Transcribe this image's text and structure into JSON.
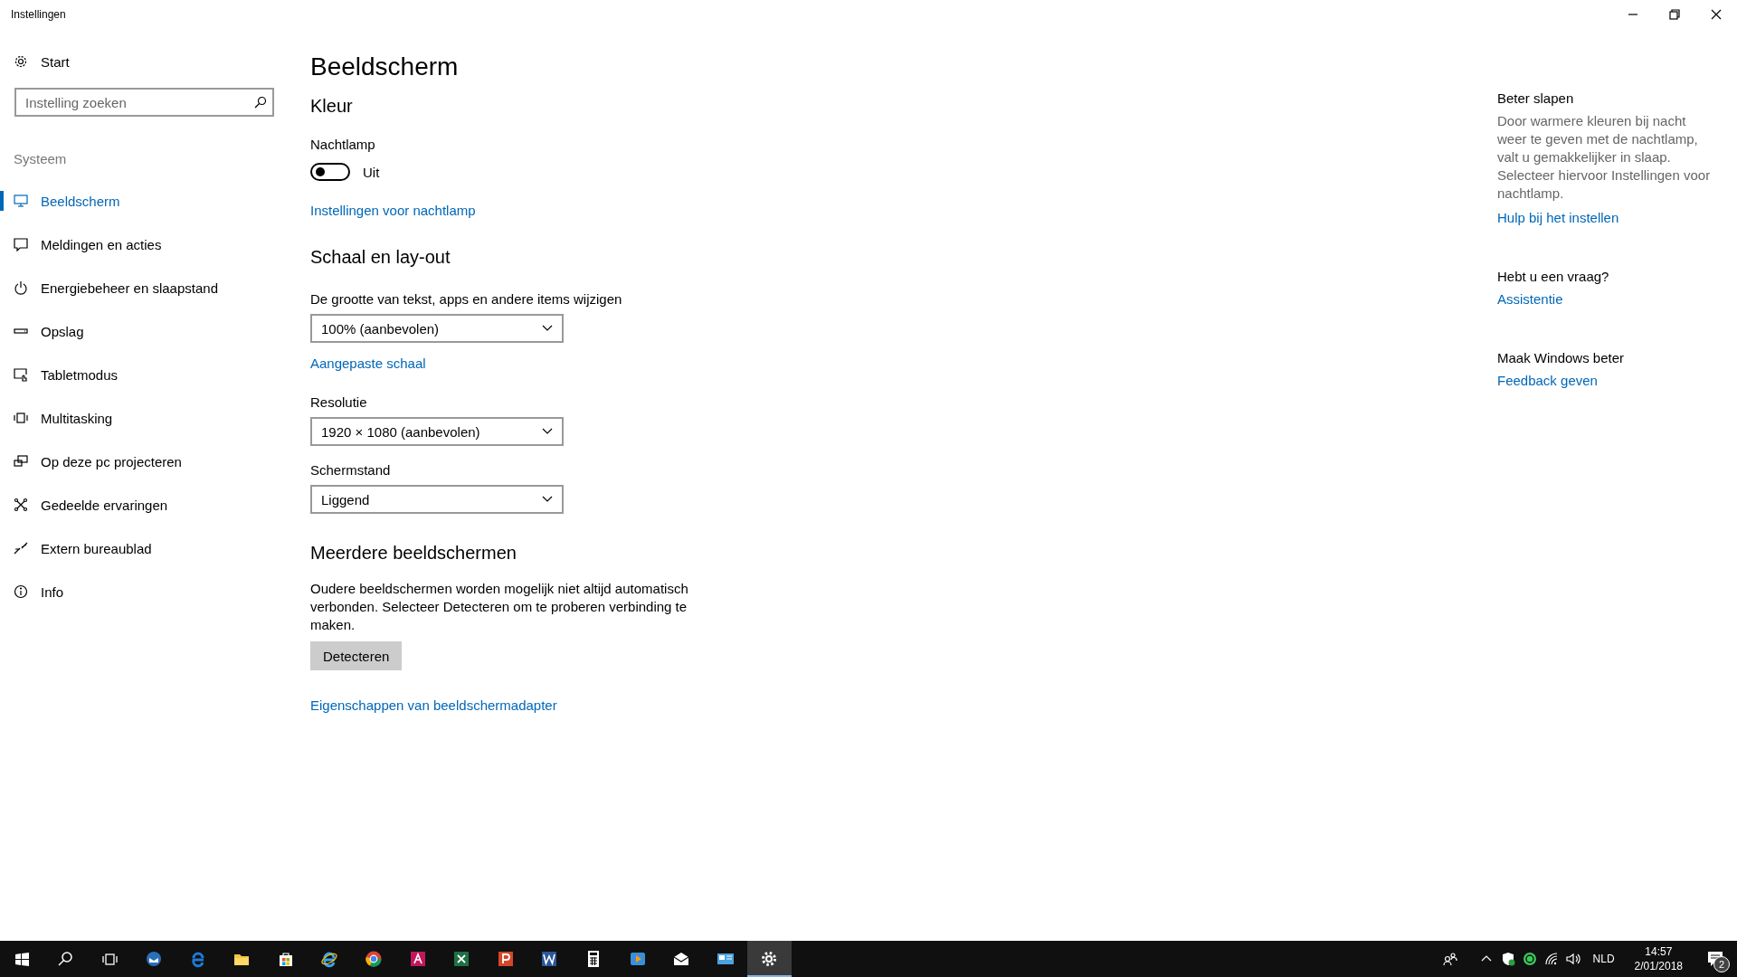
{
  "window": {
    "title": "Instellingen"
  },
  "sidebar": {
    "home": {
      "label": "Start"
    },
    "search": {
      "placeholder": "Instelling zoeken"
    },
    "section": "Systeem",
    "items": [
      {
        "label": "Beeldscherm",
        "selected": true
      },
      {
        "label": "Meldingen en acties",
        "selected": false
      },
      {
        "label": "Energiebeheer en slaapstand",
        "selected": false
      },
      {
        "label": "Opslag",
        "selected": false
      },
      {
        "label": "Tabletmodus",
        "selected": false
      },
      {
        "label": "Multitasking",
        "selected": false
      },
      {
        "label": "Op deze pc projecteren",
        "selected": false
      },
      {
        "label": "Gedeelde ervaringen",
        "selected": false
      },
      {
        "label": "Extern bureaublad",
        "selected": false
      },
      {
        "label": "Info",
        "selected": false
      }
    ]
  },
  "main": {
    "title": "Beeldscherm",
    "color": {
      "heading": "Kleur",
      "night_light": {
        "label": "Nachtlamp",
        "on": false,
        "state_text": "Uit"
      },
      "link": "Instellingen voor nachtlamp"
    },
    "scale": {
      "heading": "Schaal en lay-out",
      "size_label": "De grootte van tekst, apps en andere items wijzigen",
      "size_value": "100% (aanbevolen)",
      "link": "Aangepaste schaal",
      "resolution_label": "Resolutie",
      "resolution_value": "1920 × 1080 (aanbevolen)",
      "orientation_label": "Schermstand",
      "orientation_value": "Liggend"
    },
    "multiple": {
      "heading": "Meerdere beeldschermen",
      "text": "Oudere beeldschermen worden mogelijk niet altijd automatisch verbonden. Selecteer Detecteren om te proberen verbinding te maken.",
      "button": "Detecteren",
      "link": "Eigenschappen van beeldschermadapter"
    }
  },
  "related": [
    {
      "heading": "Beter slapen",
      "text": "Door warmere kleuren bij nacht weer te geven met de nachtlamp, valt u gemakkelijker in slaap. Selecteer hiervoor Instellingen voor nachtlamp.",
      "link": "Hulp bij het instellen"
    },
    {
      "heading": "Hebt u een vraag?",
      "link": "Assistentie"
    },
    {
      "heading": "Maak Windows beter",
      "link": "Feedback geven"
    }
  ],
  "taskbar": {
    "apps": [
      {
        "selected": false
      },
      {
        "selected": false
      },
      {
        "selected": false
      },
      {
        "selected": false
      },
      {
        "selected": false
      },
      {
        "selected": false
      },
      {
        "selected": false
      },
      {
        "selected": false
      },
      {
        "selected": false
      },
      {
        "selected": false
      },
      {
        "selected": false
      },
      {
        "selected": false
      },
      {
        "selected": true
      }
    ],
    "language": "NLD",
    "time": "14:57",
    "date": "2/01/2018",
    "notification_count": "2"
  }
}
